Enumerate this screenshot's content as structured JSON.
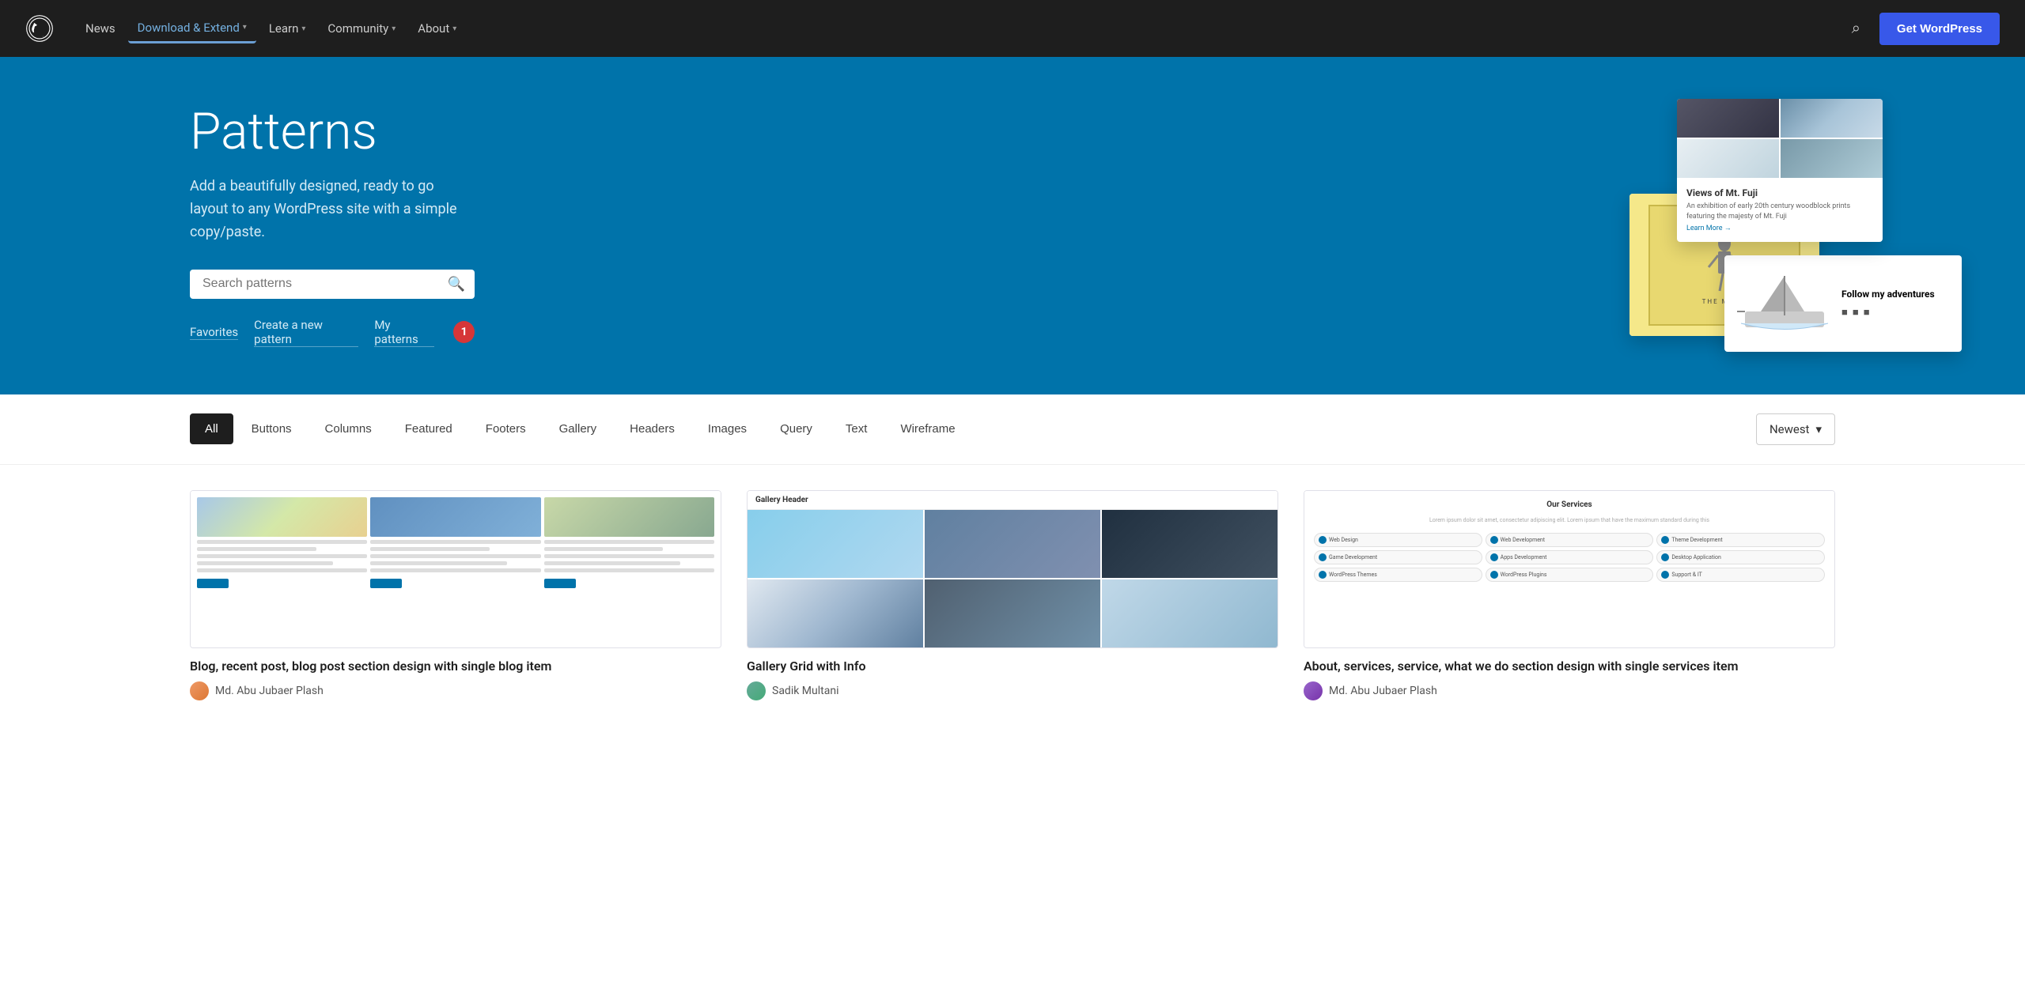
{
  "nav": {
    "logo_alt": "WordPress",
    "links": [
      {
        "label": "News",
        "active": false,
        "has_dropdown": false
      },
      {
        "label": "Download & Extend",
        "active": true,
        "has_dropdown": true
      },
      {
        "label": "Learn",
        "active": false,
        "has_dropdown": true
      },
      {
        "label": "Community",
        "active": false,
        "has_dropdown": true
      },
      {
        "label": "About",
        "active": false,
        "has_dropdown": true
      }
    ],
    "get_wordpress_label": "Get WordPress"
  },
  "hero": {
    "title": "Patterns",
    "subtitle": "Add a beautifully designed, ready to go layout to any WordPress site with a simple copy/paste.",
    "search_placeholder": "Search patterns",
    "links": [
      {
        "label": "Favorites"
      },
      {
        "label": "Create a new pattern"
      },
      {
        "label": "My patterns"
      }
    ],
    "notification_count": "1"
  },
  "filter": {
    "sort_label": "Newest",
    "tabs": [
      {
        "label": "All",
        "active": true
      },
      {
        "label": "Buttons",
        "active": false
      },
      {
        "label": "Columns",
        "active": false
      },
      {
        "label": "Featured",
        "active": false
      },
      {
        "label": "Footers",
        "active": false
      },
      {
        "label": "Gallery",
        "active": false
      },
      {
        "label": "Headers",
        "active": false
      },
      {
        "label": "Images",
        "active": false
      },
      {
        "label": "Query",
        "active": false
      },
      {
        "label": "Text",
        "active": false
      },
      {
        "label": "Wireframe",
        "active": false
      }
    ]
  },
  "patterns": [
    {
      "title": "Blog, recent post, blog post section design with single blog item",
      "author": "Md. Abu Jubaer Plash",
      "thumb_type": "blog"
    },
    {
      "title": "Gallery Grid with Info",
      "author": "Sadik Multani",
      "thumb_type": "gallery"
    },
    {
      "title": "About, services, service, what we do section design with single services item",
      "author": "Md. Abu Jubaer Plash",
      "thumb_type": "services"
    }
  ],
  "services_items": [
    "Web Design",
    "Web Development",
    "Theme Development",
    "Game Development",
    "Apps Development",
    "Desktop Application",
    "WordPress Themes",
    "WordPress Plugins",
    "Support & IT"
  ]
}
